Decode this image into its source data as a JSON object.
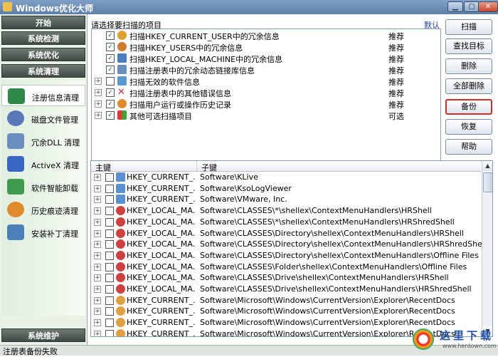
{
  "window": {
    "title": "Windows优化大师",
    "buttons": [
      "▁",
      "▢",
      "✕"
    ]
  },
  "sidebar": {
    "nav": [
      {
        "label": "开始"
      },
      {
        "label": "系统检测"
      },
      {
        "label": "系统优化"
      },
      {
        "label": "系统清理"
      }
    ],
    "sub_items": [
      {
        "label": "注册信息清理",
        "icon": "registry-icon",
        "color": "#2f8a4a"
      },
      {
        "label": "磁盘文件管理",
        "icon": "disk-icon",
        "color": "#5a78b8"
      },
      {
        "label": "冗余DLL 清理",
        "icon": "dll-icon",
        "color": "#6a8fbf"
      },
      {
        "label": "ActiveX 清理",
        "icon": "activex-icon",
        "color": "#3a66c4"
      },
      {
        "label": "软件智能卸载",
        "icon": "uninstall-icon",
        "color": "#3e9a4c"
      },
      {
        "label": "历史痕迹清理",
        "icon": "history-icon",
        "color": "#e08a2c"
      },
      {
        "label": "安装补丁清理",
        "icon": "patch-icon",
        "color": "#4a7fb8"
      }
    ],
    "bottom_nav": {
      "label": "系统维护"
    }
  },
  "scan_panel": {
    "label": "请选择要扫描的项目",
    "default_link": "默认",
    "items": [
      {
        "expand": false,
        "checked": true,
        "text": "扫描HKEY_CURRENT_USER中的冗余信息",
        "status": "推荐",
        "icon": "user-icon",
        "color": "#e0a030"
      },
      {
        "expand": false,
        "checked": true,
        "text": "扫描HKEY_USERS中的冗余信息",
        "status": "推荐",
        "icon": "users-icon",
        "color": "#d07a30"
      },
      {
        "expand": false,
        "checked": true,
        "text": "扫描HKEY_LOCAL_MACHINE中的冗余信息",
        "status": "推荐",
        "icon": "computer-icon",
        "color": "#4a7fc0"
      },
      {
        "expand": false,
        "checked": true,
        "text": "扫描注册表中的冗余动态链接库信息",
        "status": "推荐",
        "icon": "dll-icon",
        "color": "#6a8fbf"
      },
      {
        "expand": true,
        "checked": false,
        "text": "扫描无效的软件信息",
        "status": "推荐",
        "icon": "software-icon",
        "color": "#5a9ad0"
      },
      {
        "expand": true,
        "checked": true,
        "text": "扫描注册表中的其他错误信息",
        "status": "推荐",
        "icon": "error-x-icon",
        "color": "#d03030"
      },
      {
        "expand": true,
        "checked": true,
        "text": "扫描用户运行或操作历史记录",
        "status": "推荐",
        "icon": "history-icon",
        "color": "#e08a2c"
      },
      {
        "expand": true,
        "checked": true,
        "text": "其他可选扫描项目",
        "status": "可选",
        "icon": "windows-flag-icon",
        "color": "#3a8a3a"
      }
    ]
  },
  "actions": [
    {
      "label": "扫描",
      "focused": false
    },
    {
      "label": "查找目标",
      "focused": false
    },
    {
      "label": "删除",
      "focused": false
    },
    {
      "label": "全部删除",
      "focused": false
    },
    {
      "label": "备份",
      "focused": true
    },
    {
      "label": "恢复",
      "focused": false
    },
    {
      "label": "帮助",
      "focused": false
    }
  ],
  "results": {
    "headers": [
      "主键",
      "子键"
    ],
    "rows": [
      {
        "key": "HKEY_CURRENT_...",
        "sub": "Software\\KLive",
        "checked": false,
        "icon": "app-icon"
      },
      {
        "key": "HKEY_CURRENT_...",
        "sub": "Software\\KsoLogViewer",
        "checked": false,
        "icon": "app-icon"
      },
      {
        "key": "HKEY_CURRENT_...",
        "sub": "Software\\VMware, Inc.",
        "checked": false,
        "icon": "app-icon"
      },
      {
        "key": "HKEY_LOCAL_MA...",
        "sub": "Software\\CLASSES\\*\\shellex\\ContextMenuHandlers\\HRShell",
        "checked": false,
        "icon": "error-icon"
      },
      {
        "key": "HKEY_LOCAL_MA...",
        "sub": "Software\\CLASSES\\*\\shellex\\ContextMenuHandlers\\HRShredShell",
        "checked": false,
        "icon": "error-icon"
      },
      {
        "key": "HKEY_LOCAL_MA...",
        "sub": "Software\\CLASSES\\Directory\\shellex\\ContextMenuHandlers\\HRShell",
        "checked": false,
        "icon": "error-icon"
      },
      {
        "key": "HKEY_LOCAL_MA...",
        "sub": "Software\\CLASSES\\Directory\\shellex\\ContextMenuHandlers\\HRShredShell",
        "checked": false,
        "icon": "error-icon"
      },
      {
        "key": "HKEY_LOCAL_MA...",
        "sub": "Software\\CLASSES\\Directory\\shellex\\ContextMenuHandlers\\Offline Files",
        "checked": false,
        "icon": "error-icon"
      },
      {
        "key": "HKEY_LOCAL_MA...",
        "sub": "Software\\CLASSES\\Folder\\shellex\\ContextMenuHandlers\\Offline Files",
        "checked": false,
        "icon": "error-icon"
      },
      {
        "key": "HKEY_LOCAL_MA...",
        "sub": "Software\\CLASSES\\Drive\\shellex\\ContextMenuHandlers\\HRShell",
        "checked": false,
        "icon": "error-icon"
      },
      {
        "key": "HKEY_LOCAL_MA...",
        "sub": "Software\\CLASSES\\Drive\\shellex\\ContextMenuHandlers\\HRShredShell",
        "checked": false,
        "icon": "error-icon"
      },
      {
        "key": "HKEY_CURRENT_...",
        "sub": "Software\\Microsoft\\Windows\\CurrentVersion\\Explorer\\RecentDocs",
        "checked": false,
        "icon": "history-icon"
      },
      {
        "key": "HKEY_CURRENT_...",
        "sub": "Software\\Microsoft\\Windows\\CurrentVersion\\Explorer\\RecentDocs",
        "checked": false,
        "icon": "history-icon"
      },
      {
        "key": "HKEY_CURRENT_...",
        "sub": "Software\\Microsoft\\Windows\\CurrentVersion\\Explorer\\RecentDocs",
        "checked": false,
        "icon": "history-icon"
      },
      {
        "key": "HKEY_CURRENT_...",
        "sub": "Software\\Microsoft\\Windows\\CurrentVersion\\Explorer\\RecentDocs",
        "checked": false,
        "icon": "history-icon"
      }
    ]
  },
  "status": {
    "message": "注册表备份失败"
  },
  "watermark": {
    "text": "这里下载",
    "url": "www.herdown.com"
  }
}
